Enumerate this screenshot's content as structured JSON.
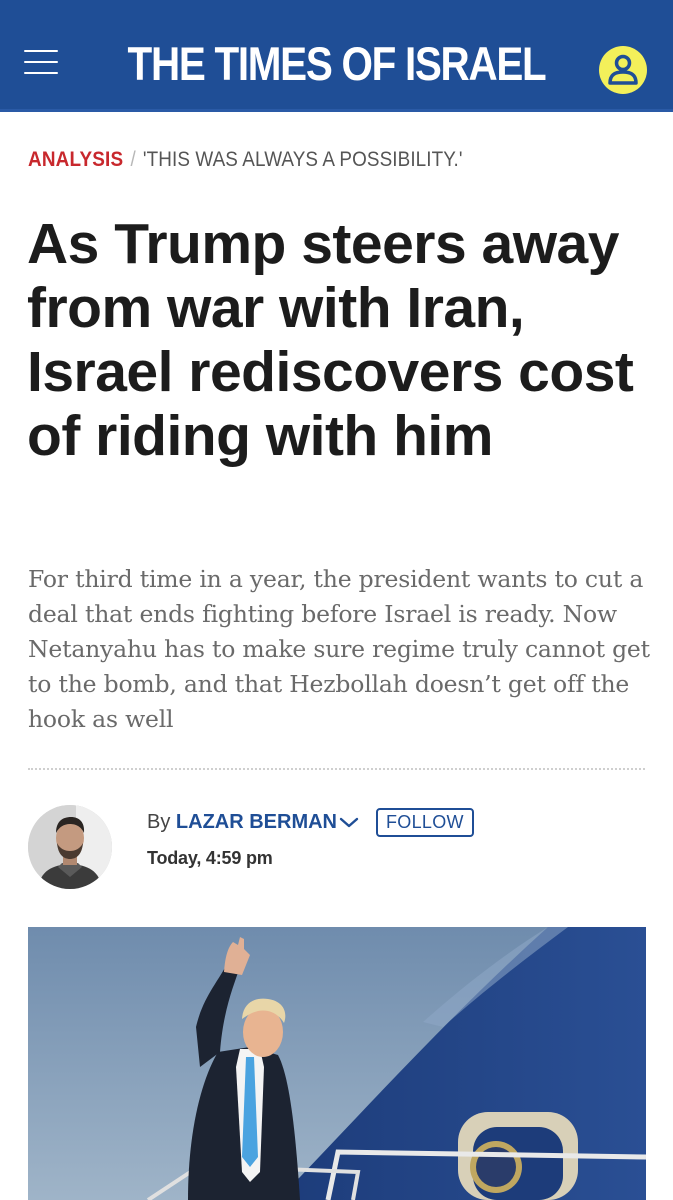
{
  "header": {
    "brand": "THE TIMES OF ISRAEL",
    "menu_icon": "hamburger-menu-icon",
    "account_icon": "user-account-icon",
    "colors": {
      "bar": "#1f4e96",
      "account": "#f3f05a"
    }
  },
  "article": {
    "category": "ANALYSIS",
    "separator": "/",
    "kicker": "'THIS WAS ALWAYS A POSSIBILITY.'",
    "headline": "As Trump steers away from war with Iran, Israel rediscovers cost of riding with him",
    "dek": "For third time in a year, the president wants to cut a deal that ends fighting before Israel is ready. Now Netanyahu has to make sure regime truly cannot get to the bomb, and that Hezbollah doesn’t get off the hook as well",
    "byline_prefix": "By",
    "author": "LAZAR BERMAN",
    "follow_label": "FOLLOW",
    "date": "Today, 4:59 pm",
    "colors": {
      "category": "#c8282d",
      "author": "#1f4e96"
    }
  }
}
